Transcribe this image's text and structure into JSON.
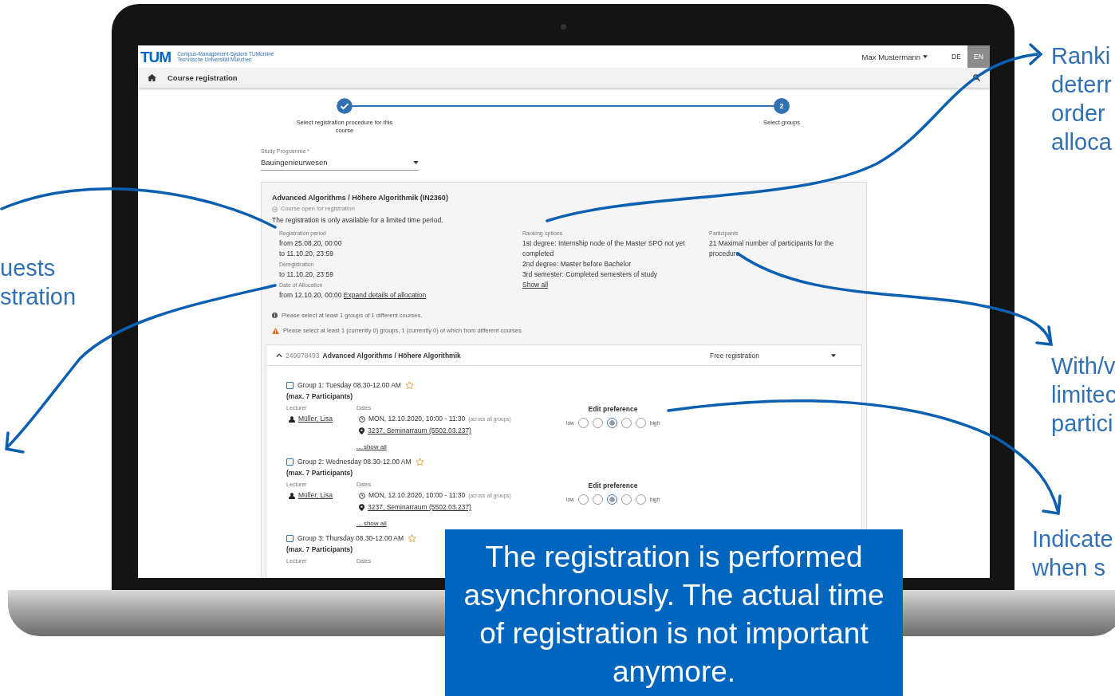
{
  "screen": {
    "header": {
      "logo_text": "TUM",
      "system_name": "Campus-Management-System TUMonline",
      "university": "Technische Universität München",
      "user_name": "Max Mustermann",
      "languages": [
        {
          "label": "DE",
          "selected": false
        },
        {
          "label": "EN",
          "selected": true
        }
      ]
    },
    "nav": {
      "title": "Course registration"
    },
    "steps": [
      {
        "kind": "done",
        "label": "Select registration procedure for this course"
      },
      {
        "kind": "current",
        "number": "2",
        "label": "Select groups"
      }
    ],
    "study_programme": {
      "label": "Study Programme *",
      "value": "Bauingenieurwesen"
    },
    "course": {
      "title": "Advanced Algorithms / Höhere Algorithmik (IN2360)",
      "status": "Course open for registration",
      "notice": "The registration is only available for a limited time period.",
      "details": [
        {
          "label": "Registration period",
          "lines": [
            "from 25.08.20, 00:00",
            "to 11.10.20, 23:59"
          ]
        },
        {
          "label": "Deregistration",
          "lines": [
            "to 11.10.20, 23:59"
          ]
        },
        {
          "label": "Date of Allocation",
          "lines": [
            "from 12.10.20, 00:00"
          ],
          "link": "Expand details of allocation"
        }
      ],
      "ranking": {
        "label": "Ranking options",
        "lines": [
          "1st degree: Internship node of the Master SPO not yet completed",
          "2nd degree: Master before Bachelor",
          "3rd semester: Completed semesters of study"
        ],
        "link": "Show all"
      },
      "participants": {
        "label": "Participants",
        "text": "21 Maximal number of participants for the procedure"
      },
      "messages": [
        {
          "kind": "info",
          "text": "Please select at least 1 groups of 1 different courses."
        },
        {
          "kind": "warning",
          "text": "Please select at least 1 (currently 0) groups, 1 (currently 0) of which from different courses."
        }
      ],
      "panel": {
        "expanded": true,
        "number": "249978493",
        "name": "Advanced Algorithms / Höhere Algorithmik",
        "mode": "Free registration",
        "groups": [
          {
            "title": "Group 1: Tuesday 08.30-12.00 AM",
            "checked": false,
            "starred": false,
            "capacity": "(max. 7 Participants)",
            "lecturer_label": "Lecturer",
            "dates_label": "Dates",
            "lecturer": "Müller, Lisa",
            "date": "MON, 12.10.2020, 10:00 - 11:30",
            "date_note": "(across all groups)",
            "room": "3237, Seminarraum (5502.03.237)",
            "show_all": "... show all",
            "preference": {
              "label": "Edit preference",
              "low": "low",
              "high": "high",
              "options": [
                {
                  "selected": false
                },
                {
                  "selected": false
                },
                {
                  "selected": true
                },
                {
                  "selected": false
                },
                {
                  "selected": false
                }
              ]
            }
          },
          {
            "title": "Group 2: Wednesday 08.30-12.00 AM",
            "checked": false,
            "starred": false,
            "capacity": "(max. 7 Participants)",
            "lecturer_label": "Lecturer",
            "dates_label": "Dates",
            "lecturer": "Müller, Lisa",
            "date": "MON, 12.10.2020, 10:00 - 11:30",
            "date_note": "(across all groups)",
            "room": "3237, Seminarraum (5502.03.237)",
            "show_all": "... show all",
            "preference": {
              "label": "Edit preference",
              "low": "low",
              "high": "high",
              "options": [
                {
                  "selected": false
                },
                {
                  "selected": false
                },
                {
                  "selected": true
                },
                {
                  "selected": false
                },
                {
                  "selected": false
                }
              ]
            }
          },
          {
            "title": "Group 3: Thursday 08.30-12.00 AM",
            "checked": false,
            "starred": false,
            "capacity": "(max. 7 Participants)",
            "lecturer_label": "Lecturer",
            "dates_label": "Dates"
          }
        ]
      }
    }
  },
  "annotations": [
    {
      "lines": [
        "Ranki",
        "deterr",
        "order",
        "alloca"
      ]
    },
    {
      "lines": [
        "uests",
        "stration"
      ]
    },
    {
      "lines": [
        "With/v",
        "limitec",
        "partici"
      ]
    },
    {
      "lines": [
        "Indicate",
        "when s"
      ]
    }
  ],
  "callout": "The registration is performed asynchronously. The actual time of registration is not important anymore."
}
